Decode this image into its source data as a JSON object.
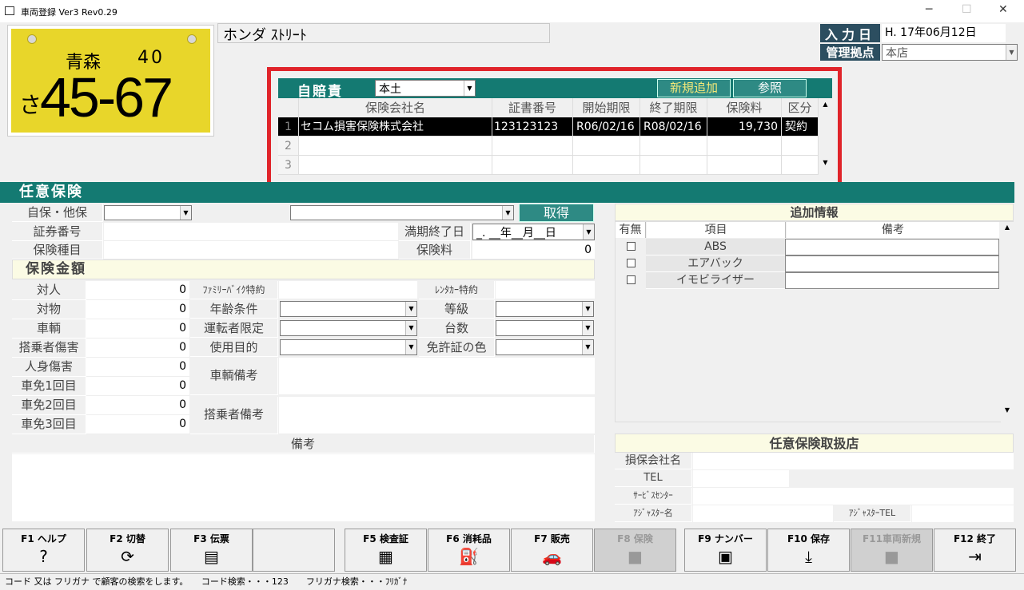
{
  "window": {
    "title": "車両登録 Ver3 Rev0.29",
    "min": "─",
    "max": "☐",
    "close": "✕"
  },
  "plate": {
    "prefecture": "青森",
    "class": "40",
    "kana": "さ",
    "number": "45-67"
  },
  "car_name": "ホンダ ｽﾄﾘｰﾄ",
  "header": {
    "input_date_label": "入力日",
    "input_date": "H. 17年06月12日",
    "branch_label": "管理拠点",
    "branch": "本店"
  },
  "jibaiseki": {
    "label": "自賠責",
    "region": "本土",
    "add_button": "新規追加",
    "ref_button": "参照",
    "columns": [
      "保険会社名",
      "証書番号",
      "開始期限",
      "終了期限",
      "保険料",
      "区分"
    ],
    "rows": [
      {
        "no": "1",
        "company": "セコム損害保険株式会社",
        "cert": "123123123",
        "start": "R06/02/16",
        "end": "R08/02/16",
        "fee": "19,730",
        "kind": "契約"
      },
      {
        "no": "2",
        "company": "",
        "cert": "",
        "start": "",
        "end": "",
        "fee": "",
        "kind": ""
      },
      {
        "no": "3",
        "company": "",
        "cert": "",
        "start": "",
        "end": "",
        "fee": "",
        "kind": ""
      }
    ]
  },
  "nini": {
    "section": "任意保険",
    "self_other": "自保・他保",
    "get_button": "取得",
    "policy_no": "証券番号",
    "expire": "満期終了日",
    "expire_val": "_. __年__月__日",
    "kind": "保険種目",
    "premium": "保険料",
    "premium_val": "0",
    "amount_header": "保険金額",
    "amounts": [
      {
        "label": "対人",
        "value": "0"
      },
      {
        "label": "対物",
        "value": "0"
      },
      {
        "label": "車輌",
        "value": "0"
      },
      {
        "label": "搭乗者傷害",
        "value": "0"
      },
      {
        "label": "人身傷害",
        "value": "0"
      },
      {
        "label": "車免1回目",
        "value": "0"
      },
      {
        "label": "車免2回目",
        "value": "0"
      },
      {
        "label": "車免3回目",
        "value": "0"
      }
    ],
    "family_bike": "ﾌｧﾐﾘｰﾊﾞｲｸ特約",
    "rental": "ﾚﾝﾀｶｰ特約",
    "age": "年齢条件",
    "grade": "等級",
    "driver": "運転者限定",
    "count": "台数",
    "purpose": "使用目的",
    "license": "免許証の色",
    "vehicle_note": "車輌備考",
    "passenger_note": "搭乗者備考",
    "notes": "備考"
  },
  "extra": {
    "title": "追加情報",
    "col_has": "有無",
    "col_item": "項目",
    "col_note": "備考",
    "items": [
      "ABS",
      "エアバック",
      "イモビライザー"
    ]
  },
  "shop": {
    "title": "任意保険取扱店",
    "company": "損保会社名",
    "tel": "TEL",
    "service": "ｻｰﾋﾞｽｾﾝﾀｰ",
    "adjuster": "ｱｼﾞｬｽﾀｰ名",
    "adjuster_tel": "ｱｼﾞｬｽﾀｰTEL"
  },
  "fkeys": [
    {
      "label": "F1 ヘルプ",
      "icon": "?"
    },
    {
      "label": "F2 切替",
      "icon": "⟳"
    },
    {
      "label": "F3 伝票",
      "icon": "▤"
    },
    {
      "label": "",
      "icon": ""
    },
    {
      "label": "F5 検査証",
      "icon": "▦"
    },
    {
      "label": "F6 消耗品",
      "icon": "⛽"
    },
    {
      "label": "F7 販売",
      "icon": "🚗"
    },
    {
      "label": "F8 保険",
      "icon": "■"
    },
    {
      "label": "F9 ナンバー",
      "icon": "▣"
    },
    {
      "label": "F10 保存",
      "icon": "⤓"
    },
    {
      "label": "F11車両新規",
      "icon": "■"
    },
    {
      "label": "F12 終了",
      "icon": "⇥"
    }
  ],
  "status": "コード 又は フリガナ で顧客の検索をします。　　コード検索・・・123　　フリガナ検索・・・ﾌﾘｶﾞﾅ"
}
